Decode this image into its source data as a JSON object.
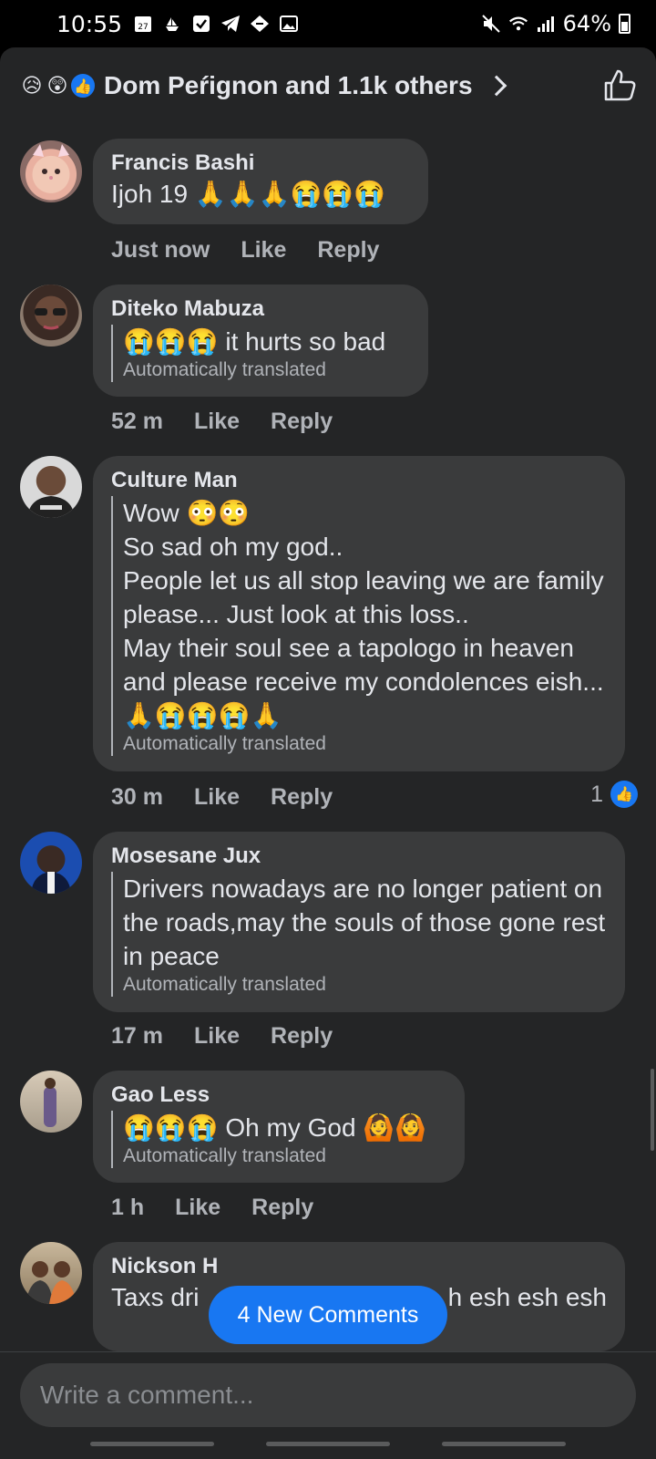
{
  "status_bar": {
    "time": "10:55",
    "calendar_day": "27",
    "battery": "64%"
  },
  "reactions": {
    "emojis": [
      "😥",
      "😲",
      "👍"
    ],
    "summary": "Dom Peŕignon and 1.1k others"
  },
  "comments": [
    {
      "author": "Francis Bashi",
      "text": "Ijoh 19 🙏🙏🙏😭😭😭",
      "translated": "",
      "time": "Just now",
      "like_label": "Like",
      "reply_label": "Reply",
      "likes": ""
    },
    {
      "author": "Diteko Mabuza",
      "text": "😭😭😭 it hurts so bad",
      "translated": "Automatically translated",
      "time": "52 m",
      "like_label": "Like",
      "reply_label": "Reply",
      "likes": ""
    },
    {
      "author": "Culture Man",
      "text": "Wow 😳😳\nSo sad oh my god..\nPeople let us all stop leaving we are family please... Just look at this loss..\nMay their soul see a tapologo in heaven and please receive my condolences eish... 🙏😭😭😭🙏",
      "translated": "Automatically translated",
      "time": "30 m",
      "like_label": "Like",
      "reply_label": "Reply",
      "likes": "1"
    },
    {
      "author": "Mosesane Jux",
      "text": "Drivers nowadays are no longer patient on the roads,may the souls of those gone rest in peace",
      "translated": "Automatically translated",
      "time": "17 m",
      "like_label": "Like",
      "reply_label": "Reply",
      "likes": ""
    },
    {
      "author": "Gao Less",
      "text": "😭😭😭 Oh my God 🙆🙆",
      "translated": "Automatically translated",
      "time": "1 h",
      "like_label": "Like",
      "reply_label": "Reply",
      "likes": ""
    },
    {
      "author": "Nickson H",
      "text": "Taxs dri",
      "text_right": "h esh esh esh",
      "translated": "",
      "time": "",
      "like_label": "",
      "reply_label": "",
      "likes": ""
    }
  ],
  "new_comments_label": "4 New Comments",
  "composer": {
    "placeholder": "Write a comment..."
  },
  "colors": {
    "accent": "#1877f2",
    "background": "#242526",
    "bubble": "#3a3b3c"
  }
}
